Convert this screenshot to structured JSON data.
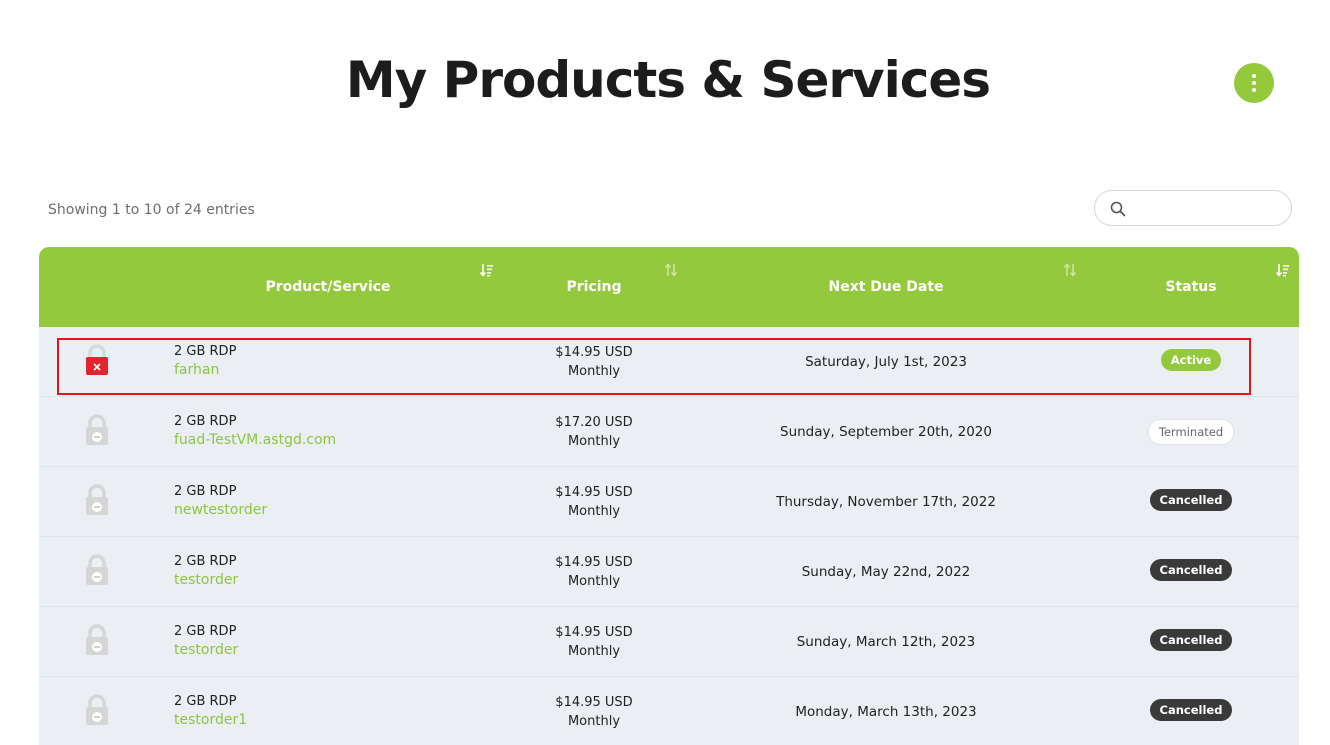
{
  "page": {
    "title": "My Products & Services"
  },
  "entries_info": "Showing 1 to 10 of 24 entries",
  "search": {
    "placeholder": ""
  },
  "table": {
    "columns": [
      "Product/Service",
      "Pricing",
      "Next Due Date",
      "Status"
    ],
    "rows": [
      {
        "product": "2 GB RDP",
        "domain": "farhan",
        "price": "$14.95 USD",
        "cycle": "Monthly",
        "next_due": "Saturday, July 1st, 2023",
        "status": "Active",
        "icon": "lock-icon-red-x"
      },
      {
        "product": "2 GB RDP",
        "domain": "fuad-TestVM.astgd.com",
        "price": "$17.20 USD",
        "cycle": "Monthly",
        "next_due": "Sunday, September 20th, 2020",
        "status": "Terminated",
        "icon": "lock-icon-gray"
      },
      {
        "product": "2 GB RDP",
        "domain": "newtestorder",
        "price": "$14.95 USD",
        "cycle": "Monthly",
        "next_due": "Thursday, November 17th, 2022",
        "status": "Cancelled",
        "icon": "lock-icon-gray"
      },
      {
        "product": "2 GB RDP",
        "domain": "testorder",
        "price": "$14.95 USD",
        "cycle": "Monthly",
        "next_due": "Sunday, May 22nd, 2022",
        "status": "Cancelled",
        "icon": "lock-icon-gray"
      },
      {
        "product": "2 GB RDP",
        "domain": "testorder",
        "price": "$14.95 USD",
        "cycle": "Monthly",
        "next_due": "Sunday, March 12th, 2023",
        "status": "Cancelled",
        "icon": "lock-icon-gray"
      },
      {
        "product": "2 GB RDP",
        "domain": "testorder1",
        "price": "$14.95 USD",
        "cycle": "Monthly",
        "next_due": "Monday, March 13th, 2023",
        "status": "Cancelled",
        "icon": "lock-icon-gray"
      }
    ]
  },
  "colors": {
    "accent": "#95c93d",
    "row_bg": "#ebeef3",
    "domain_link": "#8cc63f",
    "highlight": "#e4141b",
    "cancelled_badge": "#3a3a3a"
  }
}
